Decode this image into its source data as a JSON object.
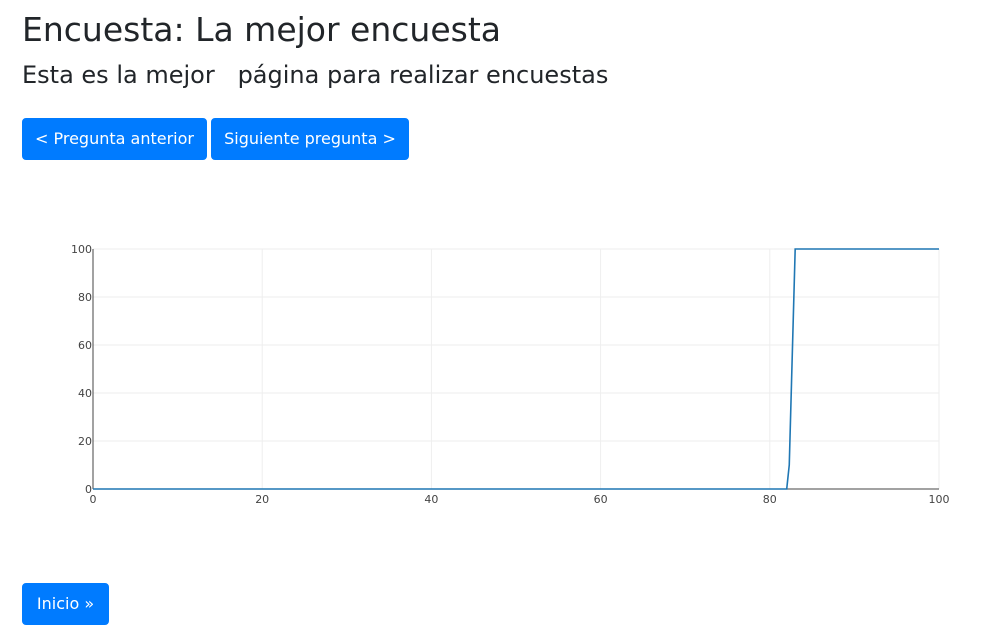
{
  "header": {
    "title": "Encuesta: La mejor encuesta",
    "subtitle": "Esta es la mejor   página para realizar encuestas"
  },
  "nav": {
    "prev_label": "< Pregunta anterior",
    "next_label": "Siguiente pregunta >"
  },
  "footer": {
    "home_label": "Inicio »"
  },
  "colors": {
    "accent": "#007bff",
    "line": "#1f77b4",
    "grid": "#eeeeee",
    "axis": "#444444"
  },
  "chart_data": {
    "type": "line",
    "title": "",
    "xlabel": "",
    "ylabel": "",
    "xlim": [
      0,
      100
    ],
    "ylim": [
      0,
      100
    ],
    "x_ticks": [
      0,
      20,
      40,
      60,
      80,
      100
    ],
    "y_ticks": [
      0,
      20,
      40,
      60,
      80,
      100
    ],
    "grid": true,
    "series": [
      {
        "x": [
          0,
          82,
          82.3,
          83,
          100
        ],
        "y": [
          0,
          0,
          10,
          100,
          100
        ]
      }
    ]
  }
}
